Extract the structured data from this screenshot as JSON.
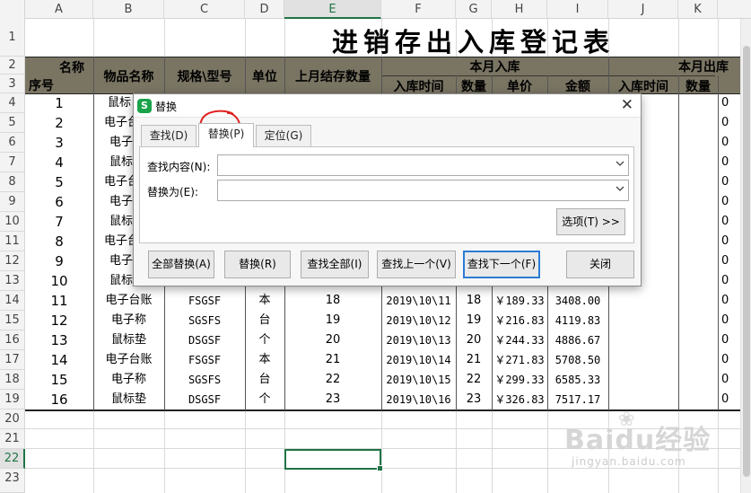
{
  "columns": [
    "A",
    "B",
    "C",
    "D",
    "E",
    "F",
    "G",
    "H",
    "I",
    "J",
    "K"
  ],
  "selected_column": "E",
  "rows": [
    "1",
    "2",
    "3",
    "4",
    "5",
    "6",
    "7",
    "8",
    "9",
    "10",
    "11",
    "12",
    "13",
    "14",
    "15",
    "16",
    "17",
    "18",
    "19",
    "20",
    "21",
    "22",
    "23"
  ],
  "selected_row": "22",
  "sheet": {
    "title": "进销存出入库登记表",
    "header": {
      "name_label": "名称",
      "seq_label": "序号",
      "product_name": "物品名称",
      "spec_model": "规格\\型号",
      "unit": "单位",
      "last_month_stock": "上月结存数量",
      "month_in": "本月入库",
      "in_time": "入库时间",
      "in_qty": "数量",
      "in_price": "单价",
      "in_amount": "金额",
      "month_out": "本月出库",
      "out_time": "入库时间",
      "out_qty": "数量"
    },
    "partial_rows": [
      {
        "seq": "1",
        "name": "鼠标",
        "out_qty": "0"
      },
      {
        "seq": "2",
        "name": "电子台",
        "out_qty": "0"
      },
      {
        "seq": "3",
        "name": "电子",
        "out_qty": "0"
      },
      {
        "seq": "4",
        "name": "鼠标",
        "out_qty": "0"
      },
      {
        "seq": "5",
        "name": "电子台",
        "out_qty": "0"
      },
      {
        "seq": "6",
        "name": "电子",
        "out_qty": "0"
      },
      {
        "seq": "7",
        "name": "鼠标",
        "out_qty": "0"
      },
      {
        "seq": "8",
        "name": "电子台",
        "out_qty": "0"
      },
      {
        "seq": "9",
        "name": "电子",
        "out_qty": "0"
      },
      {
        "seq": "10",
        "name": "鼠标",
        "out_qty": "0"
      }
    ],
    "full_rows": [
      {
        "seq": "11",
        "name": "电子台账",
        "spec": "FSGSF",
        "unit": "本",
        "stock": "18",
        "in_time": "2019\\10\\11",
        "qty": "18",
        "price": "￥189.33",
        "amount": "3408.00",
        "out_qty": "0"
      },
      {
        "seq": "12",
        "name": "电子称",
        "spec": "SGSFS",
        "unit": "台",
        "stock": "19",
        "in_time": "2019\\10\\12",
        "qty": "19",
        "price": "￥216.83",
        "amount": "4119.83",
        "out_qty": "0"
      },
      {
        "seq": "13",
        "name": "鼠标垫",
        "spec": "DSGSF",
        "unit": "个",
        "stock": "20",
        "in_time": "2019\\10\\13",
        "qty": "20",
        "price": "￥244.33",
        "amount": "4886.67",
        "out_qty": "0"
      },
      {
        "seq": "14",
        "name": "电子台账",
        "spec": "FSGSF",
        "unit": "本",
        "stock": "21",
        "in_time": "2019\\10\\14",
        "qty": "21",
        "price": "￥271.83",
        "amount": "5708.50",
        "out_qty": "0"
      },
      {
        "seq": "15",
        "name": "电子称",
        "spec": "SGSFS",
        "unit": "台",
        "stock": "22",
        "in_time": "2019\\10\\15",
        "qty": "22",
        "price": "￥299.33",
        "amount": "6585.33",
        "out_qty": "0"
      },
      {
        "seq": "16",
        "name": "鼠标垫",
        "spec": "DSGSF",
        "unit": "个",
        "stock": "23",
        "in_time": "2019\\10\\16",
        "qty": "23",
        "price": "￥326.83",
        "amount": "7517.17",
        "out_qty": "0"
      }
    ]
  },
  "dialog": {
    "logo": "S",
    "title": "替换",
    "close": "✕",
    "tabs": [
      {
        "label": "查找(D)"
      },
      {
        "label": "替换(P)"
      },
      {
        "label": "定位(G)"
      }
    ],
    "active_tab": "替换(P)",
    "find_label": "查找内容(N):",
    "find_value": "",
    "replace_label": "替换为(E):",
    "replace_value": "",
    "options_button": "选项(T) >>",
    "buttons": {
      "replace_all": "全部替换(A)",
      "replace": "替换(R)",
      "find_all": "查找全部(I)",
      "find_prev": "查找上一个(V)",
      "find_next": "查找下一个(F)",
      "close": "关闭"
    },
    "dropdown_icon": "chevron-down-icon"
  },
  "watermark": {
    "text": "Baidu经验",
    "sub": "jingyan.baidu.com"
  },
  "colors": {
    "header_band": "#7a7563",
    "selection": "#217346",
    "focus_button": "#2b7bd6",
    "annotation": "#e02020"
  }
}
